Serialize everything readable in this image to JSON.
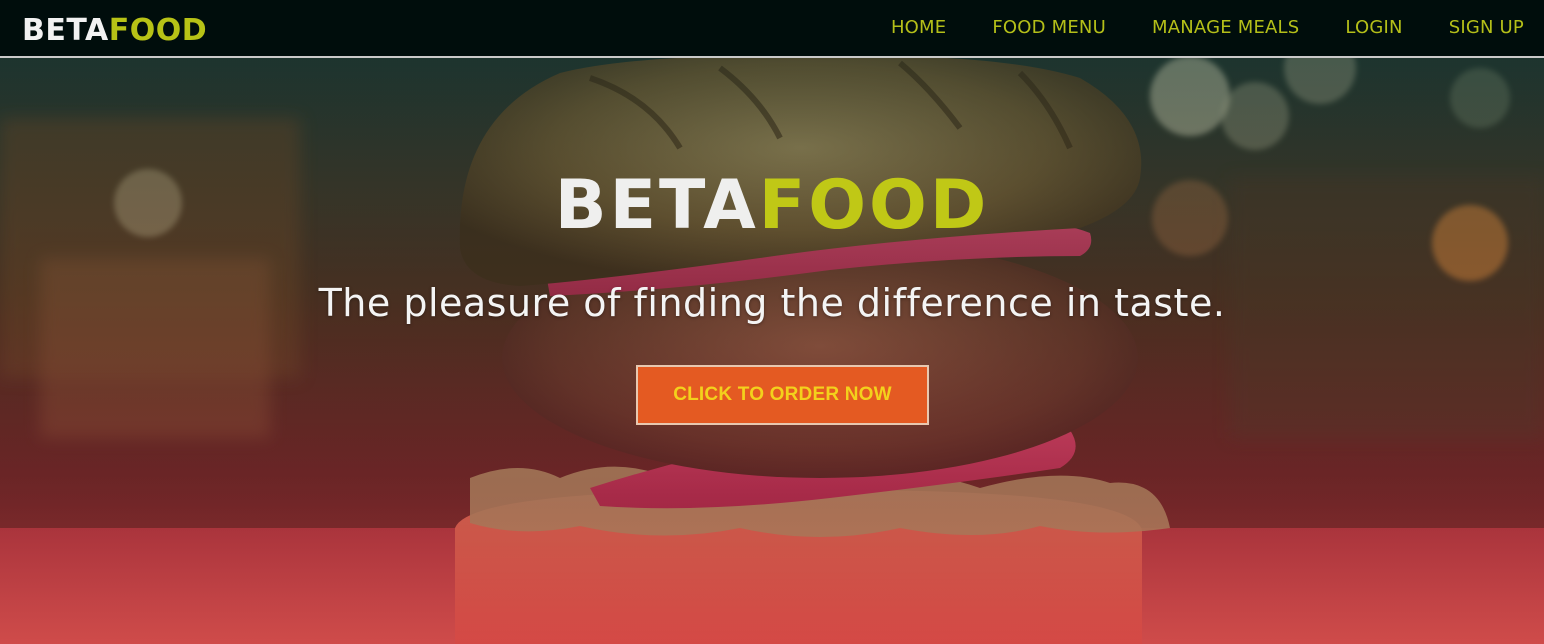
{
  "navbar": {
    "brand_part1": "BETA",
    "brand_part2": "FOOD",
    "links": [
      {
        "label": "HOME"
      },
      {
        "label": "FOOD MENU"
      },
      {
        "label": "MANAGE MEALS"
      },
      {
        "label": "LOGIN"
      },
      {
        "label": "SIGN UP"
      }
    ]
  },
  "hero": {
    "title_part1": "BETA",
    "title_part2": "FOOD",
    "tagline": "The pleasure of finding the difference in taste.",
    "cta_label": "CLICK TO ORDER NOW",
    "background_image": "burger-photo"
  },
  "colors": {
    "navbar_bg": "#000d0c",
    "brand_accent": "#b7c216",
    "nav_link": "#b4bf19",
    "cta_bg": "#e45a22",
    "cta_text": "#f3d11c"
  }
}
